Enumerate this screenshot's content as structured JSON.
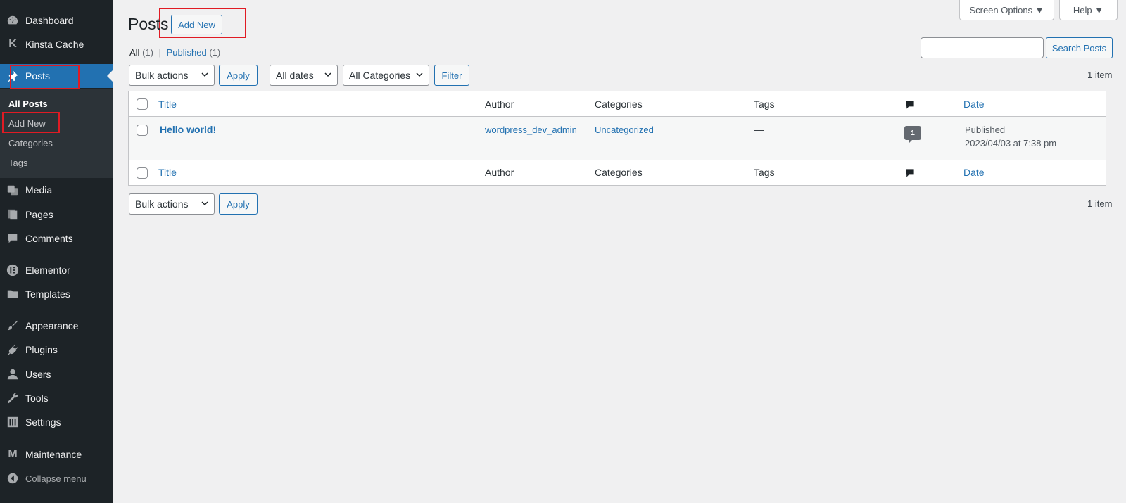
{
  "sidebar": {
    "items": [
      {
        "label": "Dashboard",
        "icon": "dashboard-icon"
      },
      {
        "label": "Kinsta Cache",
        "icon": "kinsta-icon"
      },
      {
        "label": "Posts",
        "icon": "pin-icon"
      },
      {
        "label": "Media",
        "icon": "media-icon"
      },
      {
        "label": "Pages",
        "icon": "pages-icon"
      },
      {
        "label": "Comments",
        "icon": "comments-icon"
      },
      {
        "label": "Elementor",
        "icon": "elementor-icon"
      },
      {
        "label": "Templates",
        "icon": "folder-icon"
      },
      {
        "label": "Appearance",
        "icon": "brush-icon"
      },
      {
        "label": "Plugins",
        "icon": "plug-icon"
      },
      {
        "label": "Users",
        "icon": "user-icon"
      },
      {
        "label": "Tools",
        "icon": "wrench-icon"
      },
      {
        "label": "Settings",
        "icon": "settings-icon"
      },
      {
        "label": "Maintenance",
        "icon": "maintenance-icon"
      }
    ],
    "submenu": [
      "All Posts",
      "Add New",
      "Categories",
      "Tags"
    ],
    "collapse_label": "Collapse menu"
  },
  "header": {
    "title": "Posts",
    "add_new": "Add New",
    "screen_options": "Screen Options ▼",
    "help": "Help ▼"
  },
  "filters_nav": {
    "all_label": "All",
    "all_count": "(1)",
    "separator": "|",
    "published_label": "Published",
    "published_count": "(1)"
  },
  "search": {
    "button": "Search Posts",
    "value": ""
  },
  "toolbar": {
    "bulk_actions": "Bulk actions",
    "apply": "Apply",
    "all_dates": "All dates",
    "all_categories": "All Categories",
    "filter": "Filter",
    "items_count": "1 item"
  },
  "table": {
    "columns": {
      "title": "Title",
      "author": "Author",
      "categories": "Categories",
      "tags": "Tags",
      "date": "Date"
    },
    "rows": [
      {
        "title": "Hello world!",
        "author": "wordpress_dev_admin",
        "categories": "Uncategorized",
        "tags": "—",
        "comments": "1",
        "date_status": "Published",
        "date_value": "2023/04/03 at 7:38 pm"
      }
    ]
  },
  "colors": {
    "sidebar_bg": "#1d2327",
    "accent": "#2271b1",
    "highlight": "#e01b24"
  }
}
